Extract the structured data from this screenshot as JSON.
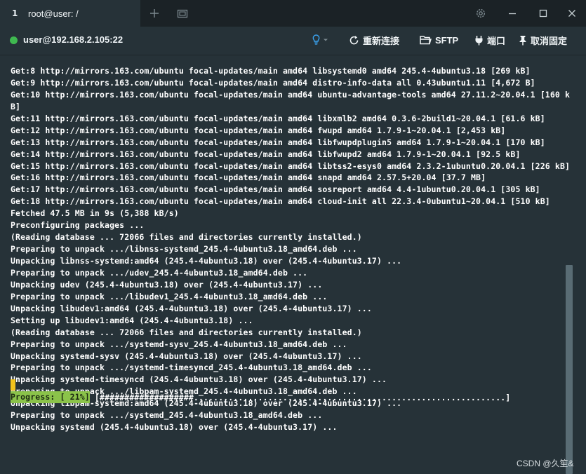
{
  "tab": {
    "number": "1",
    "title": "root@user: /"
  },
  "session": {
    "host": "user@192.168.2.105:22",
    "status_color": "#3fb950",
    "reconnect_label": "重新连接",
    "sftp_label": "SFTP",
    "port_label": "端口",
    "unpin_label": "取消固定"
  },
  "terminal": {
    "lines": [
      "Get:8 http://mirrors.163.com/ubuntu focal-updates/main amd64 libsystemd0 amd64 245.4-4ubuntu3.18 [269 kB]",
      "Get:9 http://mirrors.163.com/ubuntu focal-updates/main amd64 distro-info-data all 0.43ubuntu1.11 [4,672 B]",
      "Get:10 http://mirrors.163.com/ubuntu focal-updates/main amd64 ubuntu-advantage-tools amd64 27.11.2~20.04.1 [160 k",
      "B]",
      "Get:11 http://mirrors.163.com/ubuntu focal-updates/main amd64 libxmlb2 amd64 0.3.6-2build1~20.04.1 [61.6 kB]",
      "Get:12 http://mirrors.163.com/ubuntu focal-updates/main amd64 fwupd amd64 1.7.9-1~20.04.1 [2,453 kB]",
      "Get:13 http://mirrors.163.com/ubuntu focal-updates/main amd64 libfwupdplugin5 amd64 1.7.9-1~20.04.1 [170 kB]",
      "Get:14 http://mirrors.163.com/ubuntu focal-updates/main amd64 libfwupd2 amd64 1.7.9-1~20.04.1 [92.5 kB]",
      "Get:15 http://mirrors.163.com/ubuntu focal-updates/main amd64 libtss2-esys0 amd64 2.3.2-1ubuntu0.20.04.1 [226 kB]",
      "Get:16 http://mirrors.163.com/ubuntu focal-updates/main amd64 snapd amd64 2.57.5+20.04 [37.7 MB]",
      "Get:17 http://mirrors.163.com/ubuntu focal-updates/main amd64 sosreport amd64 4.4-1ubuntu0.20.04.1 [305 kB]",
      "Get:18 http://mirrors.163.com/ubuntu focal-updates/main amd64 cloud-init all 22.3.4-0ubuntu1~20.04.1 [510 kB]",
      "Fetched 47.5 MB in 9s (5,388 kB/s)",
      "Preconfiguring packages ...",
      "(Reading database ... 72066 files and directories currently installed.)",
      "Preparing to unpack .../libnss-systemd_245.4-4ubuntu3.18_amd64.deb ...",
      "Unpacking libnss-systemd:amd64 (245.4-4ubuntu3.18) over (245.4-4ubuntu3.17) ...",
      "Preparing to unpack .../udev_245.4-4ubuntu3.18_amd64.deb ...",
      "Unpacking udev (245.4-4ubuntu3.18) over (245.4-4ubuntu3.17) ...",
      "Preparing to unpack .../libudev1_245.4-4ubuntu3.18_amd64.deb ...",
      "Unpacking libudev1:amd64 (245.4-4ubuntu3.18) over (245.4-4ubuntu3.17) ...",
      "Setting up libudev1:amd64 (245.4-4ubuntu3.18) ...",
      "(Reading database ... 72066 files and directories currently installed.)",
      "Preparing to unpack .../systemd-sysv_245.4-4ubuntu3.18_amd64.deb ...",
      "Unpacking systemd-sysv (245.4-4ubuntu3.18) over (245.4-4ubuntu3.17) ...",
      "Preparing to unpack .../systemd-timesyncd_245.4-4ubuntu3.18_amd64.deb ...",
      "Unpacking systemd-timesyncd (245.4-4ubuntu3.18) over (245.4-4ubuntu3.17) ...",
      "Preparing to unpack .../libpam-systemd_245.4-4ubuntu3.18_amd64.deb ...",
      "Unpacking libpam-systemd:amd64 (245.4-4ubuntu3.18) over (245.4-4ubuntu3.17) ...",
      "Preparing to unpack .../systemd_245.4-4ubuntu3.18_amd64.deb ...",
      "Unpacking systemd (245.4-4ubuntu3.18) over (245.4-4ubuntu3.17) ..."
    ],
    "progress_label": "Progress: [ 21%]",
    "progress_bar": "[###################...............................................................]",
    "progress_percent": 21,
    "progress_color": "#8bc34a",
    "cursor_color": "#f2c31b"
  },
  "watermark": "CSDN @久笙&"
}
